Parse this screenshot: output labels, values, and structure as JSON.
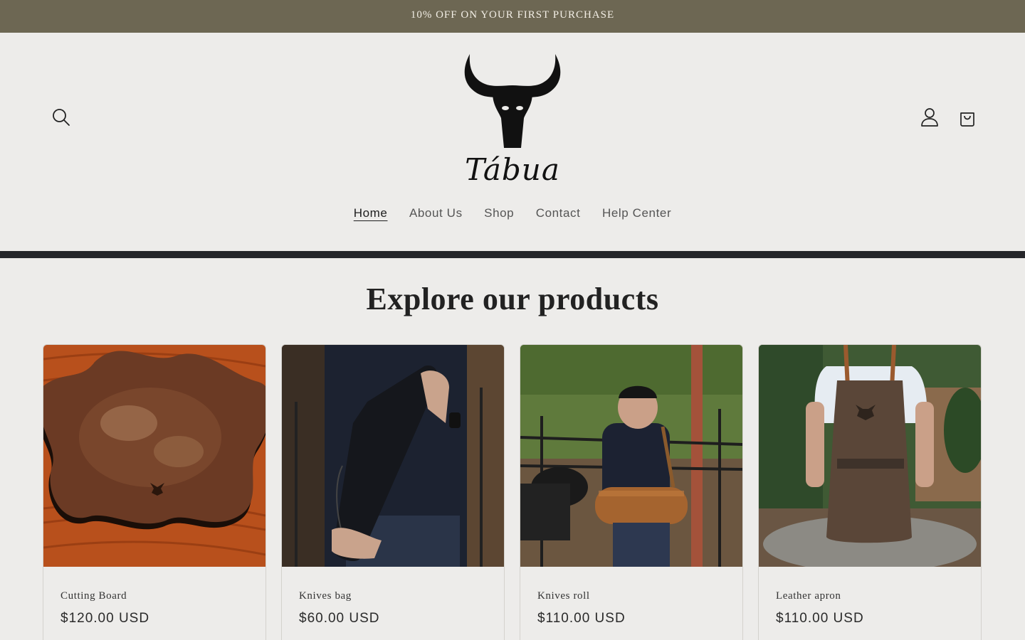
{
  "announcement": "10% OFF ON YOUR FIRST PURCHASE",
  "brand": {
    "name": "Tábua"
  },
  "nav": [
    "Home",
    "About Us",
    "Shop",
    "Contact",
    "Help Center"
  ],
  "section_title": "Explore our products",
  "products": [
    {
      "name": "Cutting Board",
      "price": "$120.00 USD"
    },
    {
      "name": "Knives bag",
      "price": "$60.00 USD"
    },
    {
      "name": "Knives roll",
      "price": "$110.00 USD"
    },
    {
      "name": "Leather apron",
      "price": "$110.00 USD"
    }
  ],
  "icons": {
    "search": "search-icon",
    "account": "account-icon",
    "cart": "cart-icon",
    "logo": "bull-skull-logo"
  },
  "colors": {
    "announcement_bg": "#6d6753",
    "divider": "#26272b",
    "page_bg": "#edecea"
  }
}
